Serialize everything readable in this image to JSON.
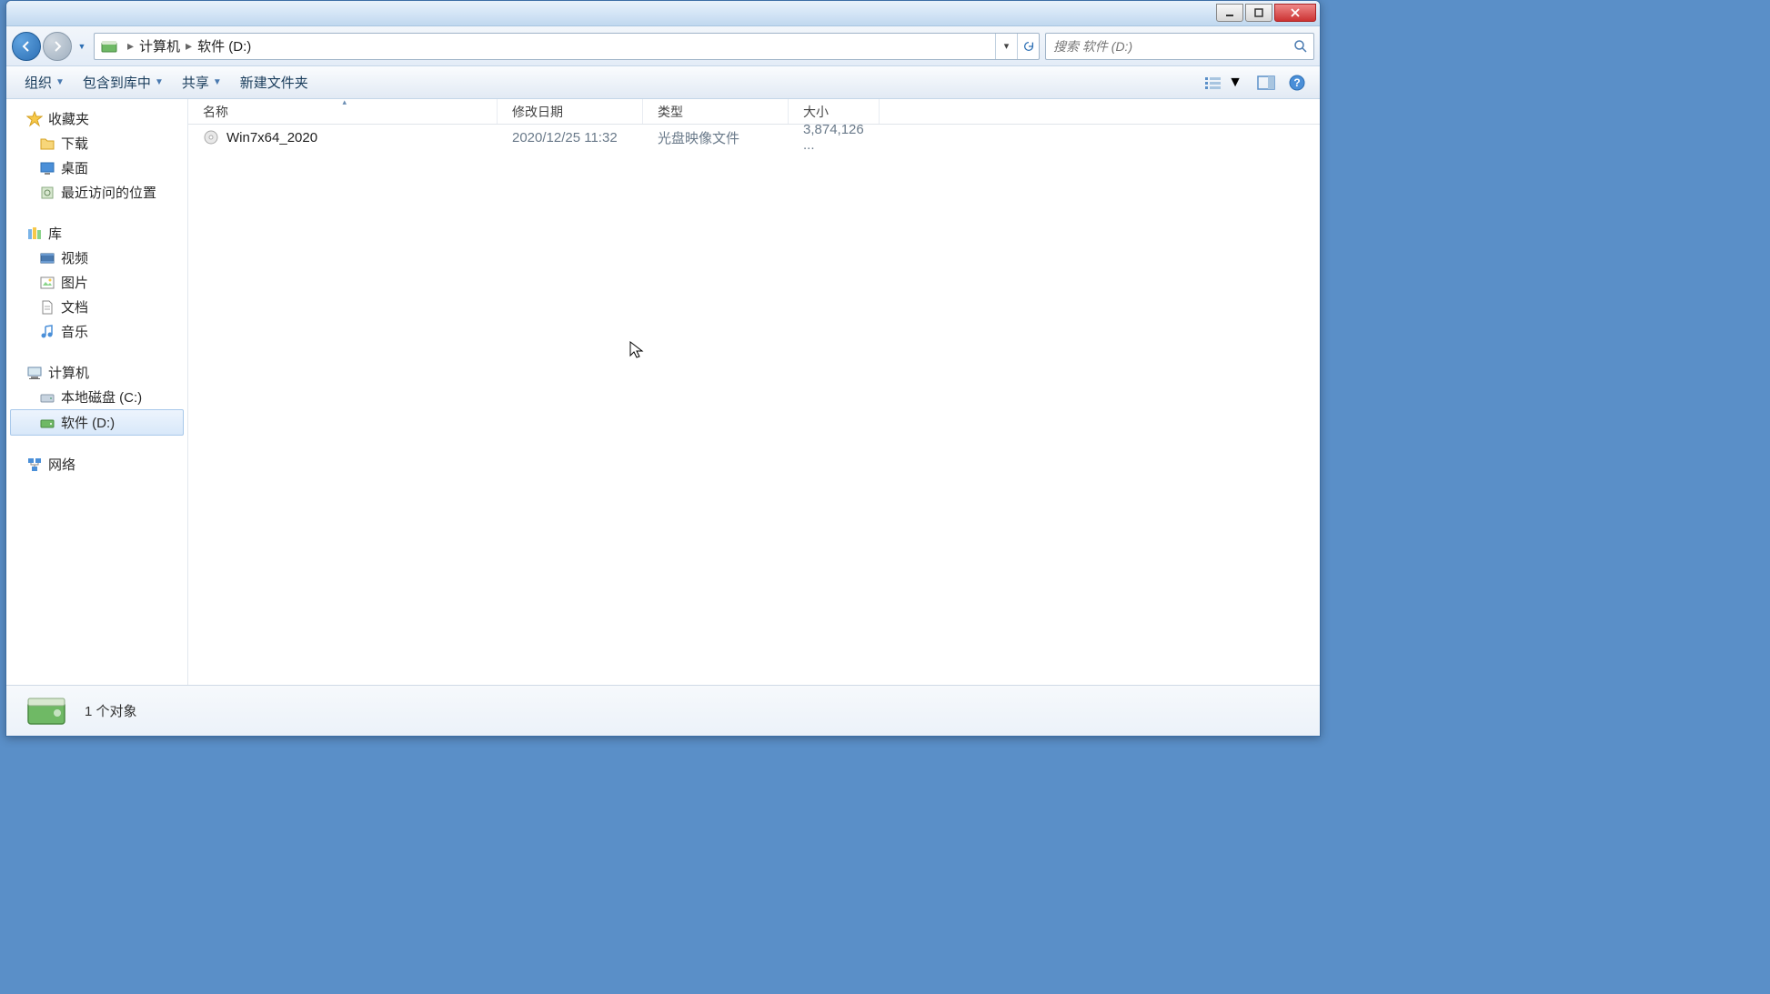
{
  "breadcrumb": {
    "seg1": "计算机",
    "seg2": "软件 (D:)"
  },
  "search": {
    "placeholder": "搜索 软件 (D:)"
  },
  "toolbar": {
    "organize": "组织",
    "include": "包含到库中",
    "share": "共享",
    "newfolder": "新建文件夹"
  },
  "columns": {
    "name": "名称",
    "date": "修改日期",
    "type": "类型",
    "size": "大小"
  },
  "sidebar": {
    "favorites": "收藏夹",
    "downloads": "下载",
    "desktop": "桌面",
    "recent": "最近访问的位置",
    "libraries": "库",
    "videos": "视频",
    "pictures": "图片",
    "documents": "文档",
    "music": "音乐",
    "computer": "计算机",
    "local_c": "本地磁盘 (C:)",
    "software_d": "软件 (D:)",
    "network": "网络"
  },
  "files": [
    {
      "name": "Win7x64_2020",
      "date": "2020/12/25 11:32",
      "type": "光盘映像文件",
      "size": "3,874,126 ..."
    }
  ],
  "status": {
    "text": "1 个对象"
  }
}
